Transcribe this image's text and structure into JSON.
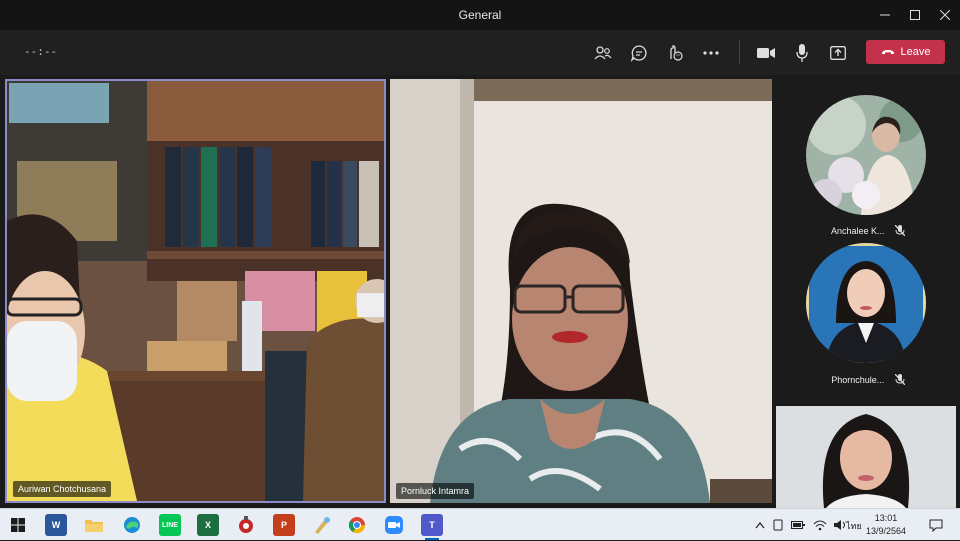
{
  "window": {
    "title": "General",
    "controls": [
      "minimize",
      "maximize",
      "close"
    ]
  },
  "toolbar": {
    "timer": "--:--",
    "icons": [
      "people-icon",
      "chat-icon",
      "reactions-icon",
      "more-icon",
      "camera-icon",
      "mic-icon",
      "share-icon"
    ],
    "leave_label": "Leave"
  },
  "participants": {
    "main": [
      {
        "name": "Auriwan Chotchusana"
      },
      {
        "name": "Pornluck Intamra"
      }
    ],
    "side": [
      {
        "name": "Anchalee K...",
        "muted": true
      },
      {
        "name": "Phornchule...",
        "muted": true
      }
    ]
  },
  "taskbar": {
    "apps": [
      "start",
      "word",
      "file-explorer",
      "edge",
      "line",
      "excel",
      "app-red",
      "powerpoint",
      "paint",
      "chrome",
      "zoom",
      "teams"
    ],
    "language": "ไทย",
    "time": "13:01",
    "date": "13/9/2564"
  },
  "colors": {
    "leave": "#c4314b",
    "active_tile_border": "#8b8cc7",
    "titlebar": "#141414",
    "toolbar": "#202020"
  }
}
